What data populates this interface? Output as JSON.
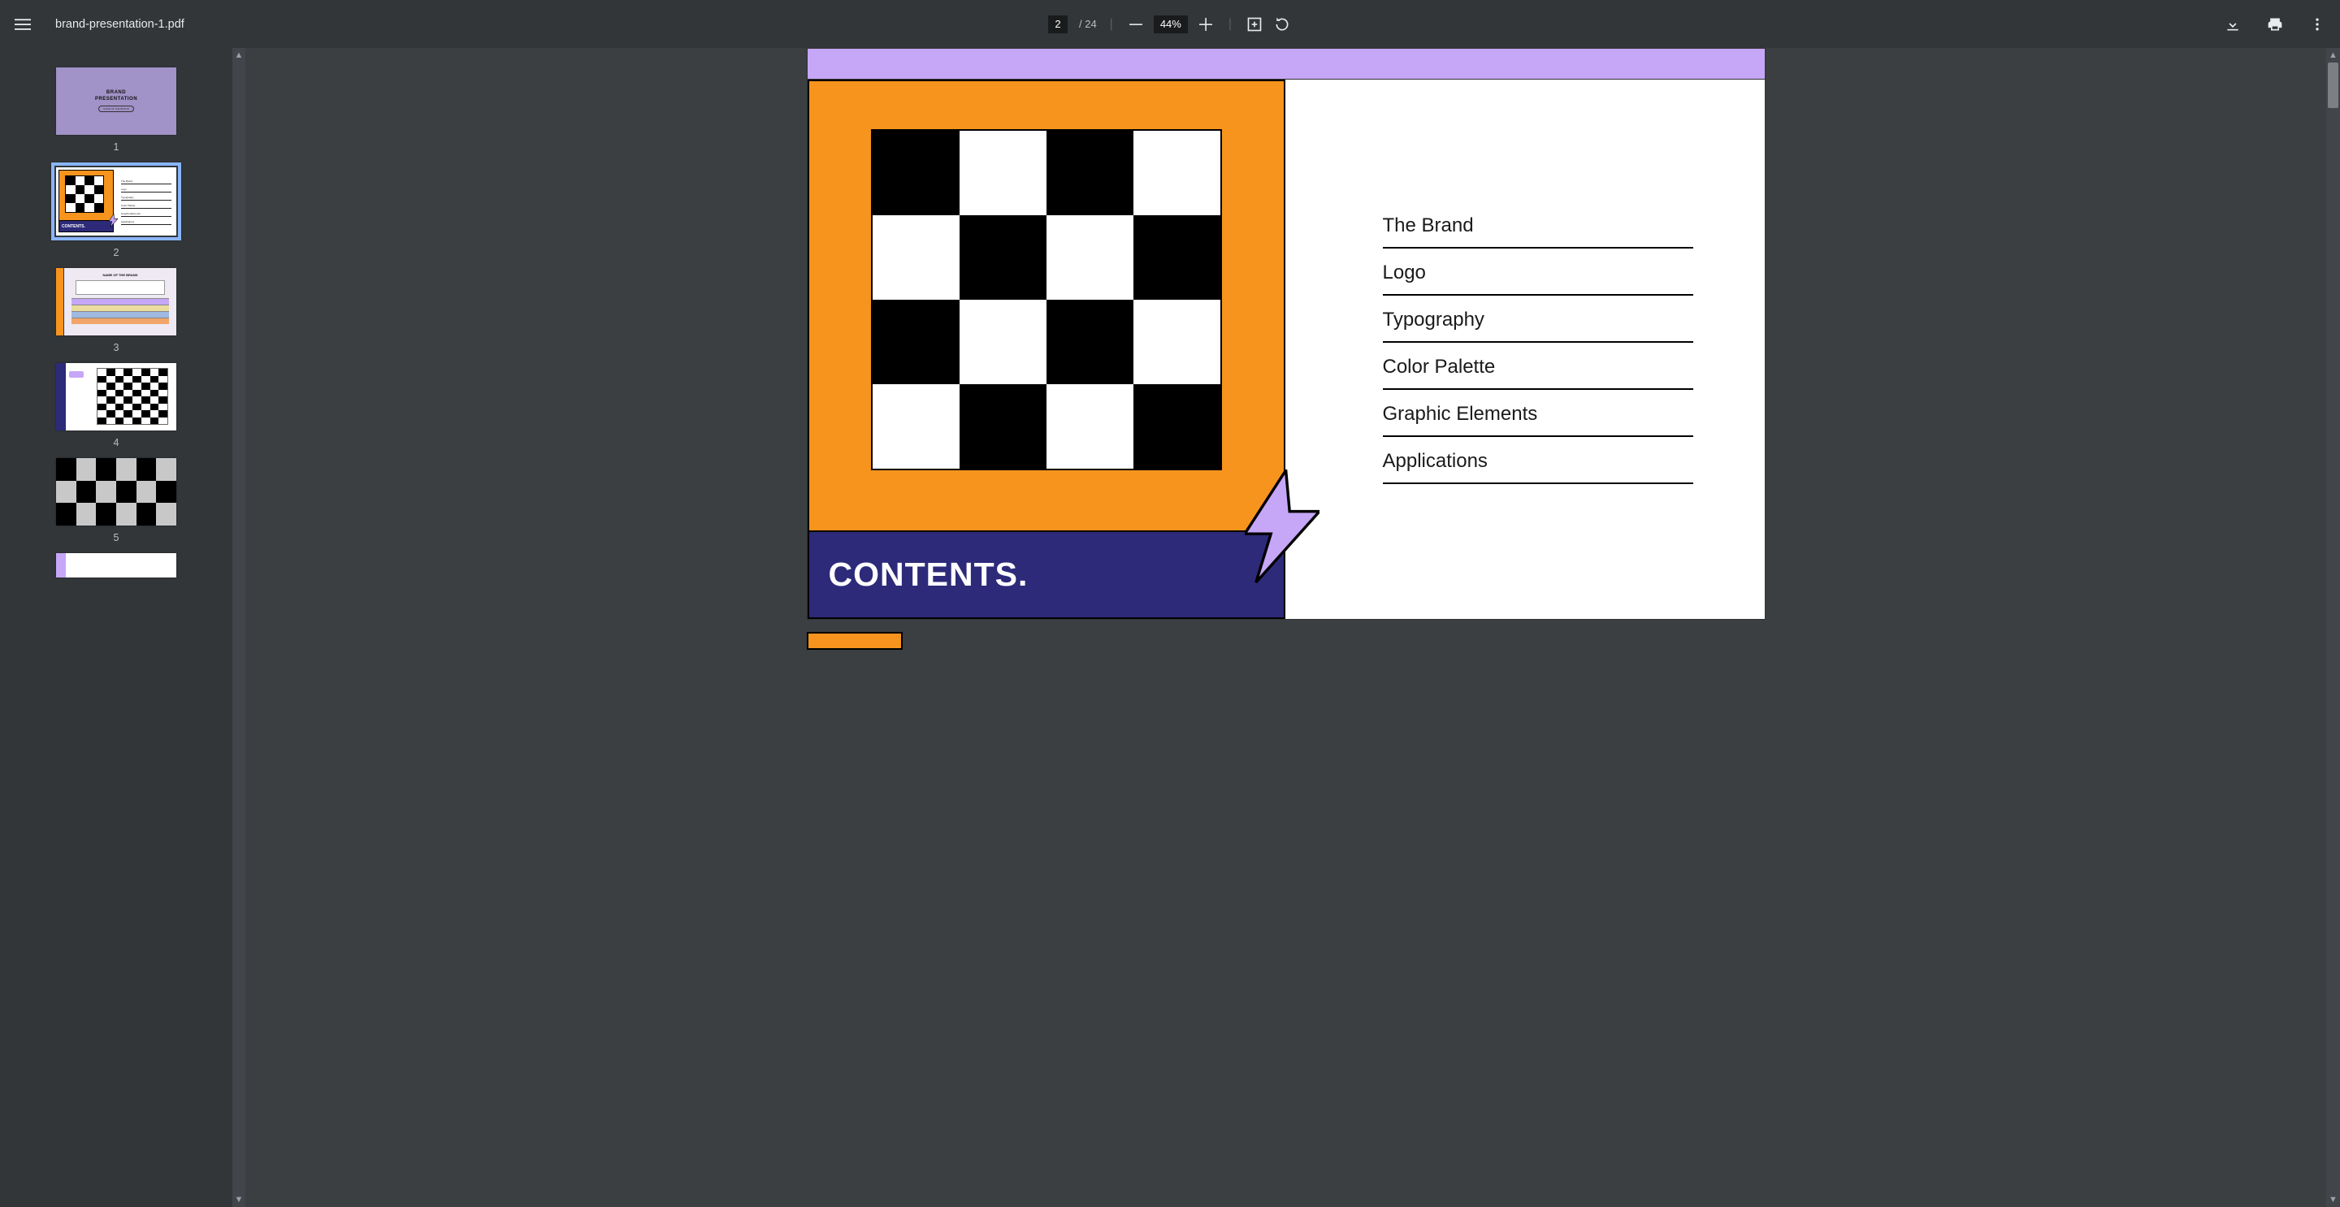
{
  "toolbar": {
    "filename": "brand-presentation-1.pdf",
    "page_current": "2",
    "page_total": "/ 24",
    "zoom": "44%"
  },
  "thumbnails": {
    "n1": "1",
    "n2": "2",
    "n3": "3",
    "n4": "4",
    "n5": "5",
    "t1_line1": "BRAND",
    "t1_line2": "PRESENTATION",
    "t1_pill": "NAME OF THE BRAND",
    "t2_title": "CONTENTS.",
    "t3_title": "NAME OF THE BRAND"
  },
  "page2": {
    "title": "CONTENTS.",
    "toc": {
      "i1": "The Brand",
      "i2": "Logo",
      "i3": "Typography",
      "i4": "Color Palette",
      "i5": "Graphic Elements",
      "i6": "Applications"
    }
  }
}
